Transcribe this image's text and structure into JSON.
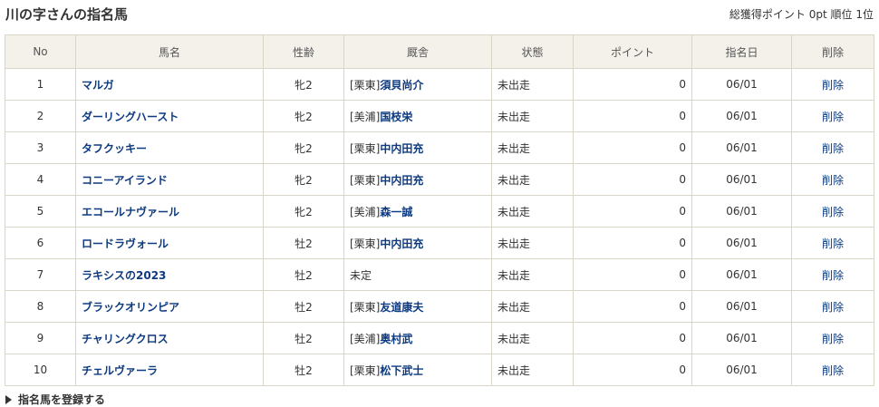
{
  "title": "川の字さんの指名馬",
  "summary": {
    "points_label": "総獲得ポイント",
    "points": "0pt",
    "rank_label": "順位",
    "rank": "1位"
  },
  "table": {
    "headers": [
      "No",
      "馬名",
      "性齢",
      "厩舎",
      "状態",
      "ポイント",
      "指名日",
      "削除"
    ],
    "rows": [
      {
        "no": "1",
        "name": "マルガ",
        "sex_age": "牝2",
        "region": "[栗東]",
        "trainer": "須貝尚介",
        "status": "未出走",
        "points": "0",
        "date": "06/01",
        "delete": "削除"
      },
      {
        "no": "2",
        "name": "ダーリングハースト",
        "sex_age": "牝2",
        "region": "[美浦]",
        "trainer": "国枝栄",
        "status": "未出走",
        "points": "0",
        "date": "06/01",
        "delete": "削除"
      },
      {
        "no": "3",
        "name": "タフクッキー",
        "sex_age": "牝2",
        "region": "[栗東]",
        "trainer": "中内田充",
        "status": "未出走",
        "points": "0",
        "date": "06/01",
        "delete": "削除"
      },
      {
        "no": "4",
        "name": "コニーアイランド",
        "sex_age": "牝2",
        "region": "[栗東]",
        "trainer": "中内田充",
        "status": "未出走",
        "points": "0",
        "date": "06/01",
        "delete": "削除"
      },
      {
        "no": "5",
        "name": "エコールナヴァール",
        "sex_age": "牝2",
        "region": "[美浦]",
        "trainer": "森一誠",
        "status": "未出走",
        "points": "0",
        "date": "06/01",
        "delete": "削除"
      },
      {
        "no": "6",
        "name": "ロードラヴォール",
        "sex_age": "牡2",
        "region": "[栗東]",
        "trainer": "中内田充",
        "status": "未出走",
        "points": "0",
        "date": "06/01",
        "delete": "削除"
      },
      {
        "no": "7",
        "name": "ラキシスの2023",
        "sex_age": "牡2",
        "region": "未定",
        "trainer": "",
        "status": "未出走",
        "points": "0",
        "date": "06/01",
        "delete": "削除"
      },
      {
        "no": "8",
        "name": "ブラックオリンピア",
        "sex_age": "牡2",
        "region": "[栗東]",
        "trainer": "友道康夫",
        "status": "未出走",
        "points": "0",
        "date": "06/01",
        "delete": "削除"
      },
      {
        "no": "9",
        "name": "チャリングクロス",
        "sex_age": "牡2",
        "region": "[美浦]",
        "trainer": "奥村武",
        "status": "未出走",
        "points": "0",
        "date": "06/01",
        "delete": "削除"
      },
      {
        "no": "10",
        "name": "チェルヴァーラ",
        "sex_age": "牡2",
        "region": "[栗東]",
        "trainer": "松下武士",
        "status": "未出走",
        "points": "0",
        "date": "06/01",
        "delete": "削除"
      }
    ]
  },
  "footer": {
    "register_label": "指名馬を登録する",
    "register_icon": "triangle-right-icon"
  },
  "colors": {
    "link": "#0d3a80",
    "header_bg": "#f3f1ea",
    "border": "#d9d6c8"
  }
}
